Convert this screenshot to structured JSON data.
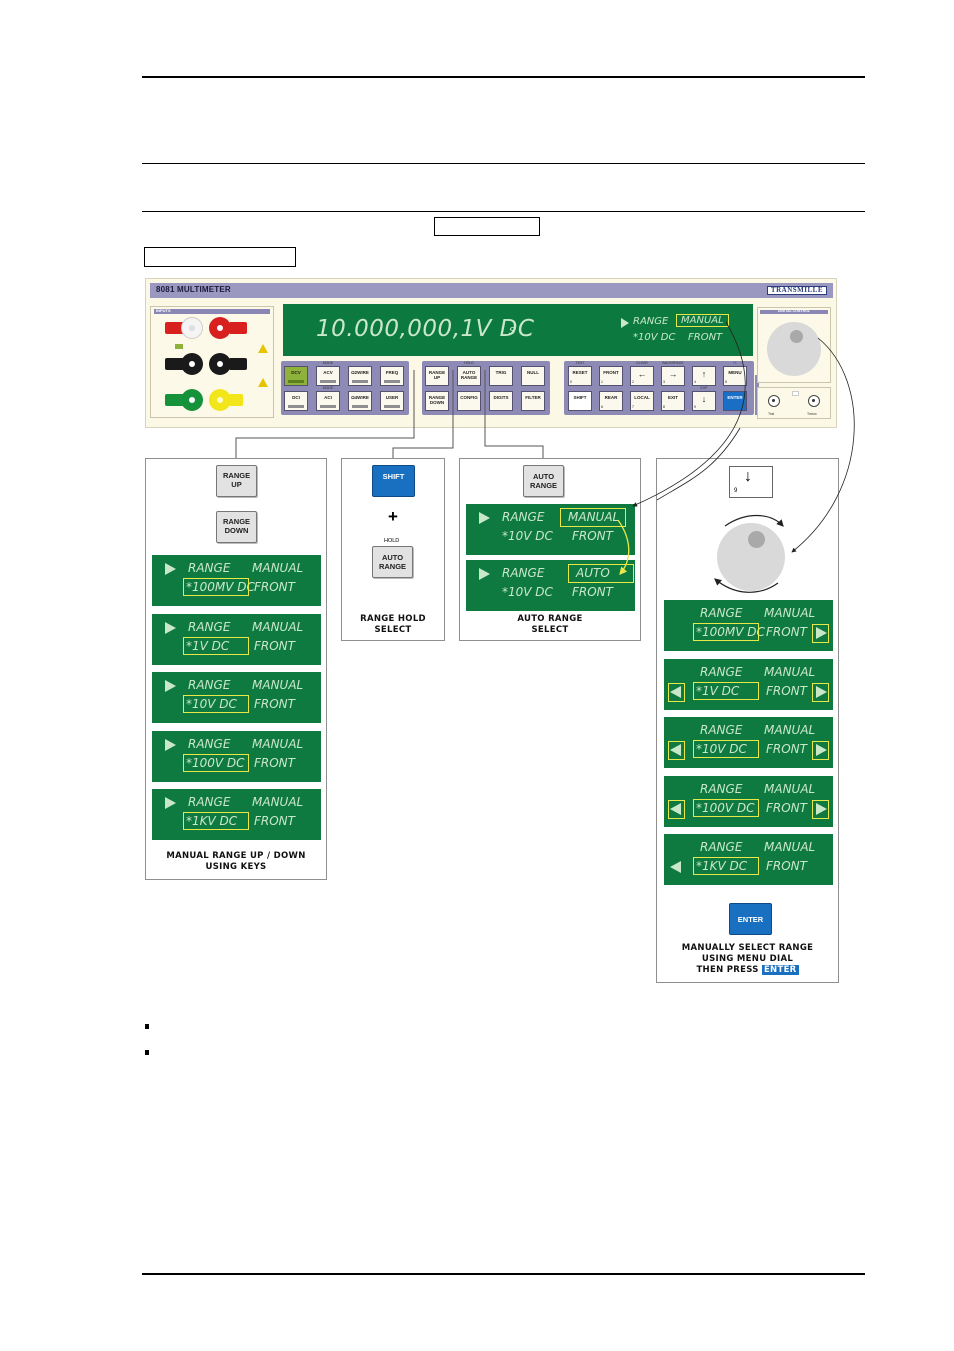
{
  "instrument": {
    "title": "8081 MULTIMETER",
    "brand": "TRANSMILLE",
    "inputs_label": "INPUTS",
    "digital_control_label": "DIGITAL CONTROL",
    "main_display": {
      "reading": "10.000,000,1V DC",
      "suffix": "S",
      "range_label": "RANGE",
      "mode": "MANUAL",
      "range_value": "*10V DC",
      "terminals": "FRONT"
    },
    "function_keys": [
      {
        "label": "DCV",
        "over": "",
        "active": true
      },
      {
        "label": "ACV",
        "over": "MODE"
      },
      {
        "label": "Ω2WIRE",
        "over": ""
      },
      {
        "label": "FREQ",
        "over": ""
      },
      {
        "label": "DCI",
        "over": ""
      },
      {
        "label": "ACI",
        "over": "MODE"
      },
      {
        "label": "Ω4WIRE",
        "over": ""
      },
      {
        "label": "USER",
        "over": ""
      }
    ],
    "range_keys": [
      {
        "label": "RANGE UP",
        "over": ""
      },
      {
        "label": "AUTO RANGE",
        "over": "HOLD"
      },
      {
        "label": "TRIG",
        "over": ""
      },
      {
        "label": "NULL",
        "over": ""
      },
      {
        "label": "RANGE DOWN",
        "over": ""
      },
      {
        "label": "CONFIG",
        "over": ""
      },
      {
        "label": "DIGITS",
        "over": ""
      },
      {
        "label": "FILTER",
        "over": ""
      }
    ],
    "menu_keys": [
      {
        "label": "RESET",
        "over": "TEST",
        "num": "0"
      },
      {
        "label": "FRONT",
        "over": "",
        "num": "1"
      },
      {
        "label": "←",
        "over": "CLEAR",
        "num": "2"
      },
      {
        "label": "→",
        "over": "BACKSPACE",
        "num": "3"
      },
      {
        "label": "↑",
        "over": ".",
        "num": "4"
      },
      {
        "label": "MENU",
        "over": "+/-",
        "num": "5"
      },
      {
        "label": "SHIFT",
        "over": "",
        "num": ""
      },
      {
        "label": "REAR",
        "over": "",
        "num": "6"
      },
      {
        "label": "LOCAL",
        "over": "",
        "num": "7"
      },
      {
        "label": "EXIT",
        "over": "",
        "num": "8"
      },
      {
        "label": "↓",
        "over": "EXP",
        "num": "9"
      },
      {
        "label": "ENTER",
        "over": "",
        "num": ""
      }
    ],
    "bnc_labels": [
      "Trat",
      "Tmsrc"
    ]
  },
  "panels": {
    "manual_keys": {
      "key_up": "RANGE UP",
      "key_down": "RANGE DOWN",
      "displays": [
        {
          "range_label": "RANGE",
          "mode": "MANUAL",
          "value": "*100MV DC",
          "terminals": "FRONT"
        },
        {
          "range_label": "RANGE",
          "mode": "MANUAL",
          "value": "*1V DC",
          "terminals": "FRONT"
        },
        {
          "range_label": "RANGE",
          "mode": "MANUAL",
          "value": "*10V DC",
          "terminals": "FRONT"
        },
        {
          "range_label": "RANGE",
          "mode": "MANUAL",
          "value": "*100V DC",
          "terminals": "FRONT"
        },
        {
          "range_label": "RANGE",
          "mode": "MANUAL",
          "value": "*1KV DC",
          "terminals": "FRONT"
        }
      ],
      "caption_line1": "MANUAL RANGE UP / DOWN",
      "caption_line2": "USING KEYS"
    },
    "range_hold": {
      "shift_key": "SHIFT",
      "plus": "+",
      "hold_label": "HOLD",
      "auto_key": "AUTO RANGE",
      "caption_line1": "RANGE HOLD",
      "caption_line2": "SELECT"
    },
    "auto_range": {
      "auto_key": "AUTO RANGE",
      "displays": [
        {
          "range_label": "RANGE",
          "mode": "MANUAL",
          "value": "*10V DC",
          "terminals": "FRONT"
        },
        {
          "range_label": "RANGE",
          "mode": "AUTO",
          "value": "*10V DC",
          "terminals": "FRONT"
        }
      ],
      "caption_line1": "AUTO RANGE",
      "caption_line2": "SELECT"
    },
    "menu_dial": {
      "down_key_glyph": "↓",
      "down_key_num": "9",
      "displays": [
        {
          "range_label": "RANGE",
          "mode": "MANUAL",
          "value": "*100MV DC",
          "terminals": "FRONT",
          "left": false,
          "right": true
        },
        {
          "range_label": "RANGE",
          "mode": "MANUAL",
          "value": "*1V DC",
          "terminals": "FRONT",
          "left": true,
          "right": true
        },
        {
          "range_label": "RANGE",
          "mode": "MANUAL",
          "value": "*10V DC",
          "terminals": "FRONT",
          "left": true,
          "right": true
        },
        {
          "range_label": "RANGE",
          "mode": "MANUAL",
          "value": "*100V DC",
          "terminals": "FRONT",
          "left": true,
          "right": true
        },
        {
          "range_label": "RANGE",
          "mode": "MANUAL",
          "value": "*1KV DC",
          "terminals": "FRONT",
          "left": true,
          "right": false
        }
      ],
      "enter_key": "ENTER",
      "caption_line1": "MANUALLY SELECT  RANGE",
      "caption_line2": "USING MENU DIAL",
      "caption_line3_prefix": "THEN PRESS ",
      "caption_line3_key": "ENTER"
    }
  },
  "colors": {
    "lcd_green": "#0f7a40",
    "highlight_yellow": "#e7e94a",
    "key_blue": "#1a70c0",
    "keypad_purple": "#8d8ab5"
  }
}
